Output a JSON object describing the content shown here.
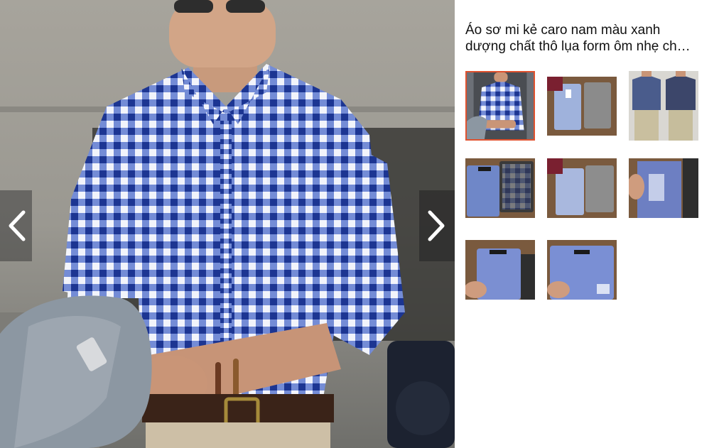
{
  "product": {
    "title_line1": "Áo sơ mi kẻ caro nam màu xanh",
    "title_line2": "dượng chất thô lụa form ôm nhẹ ch…"
  },
  "viewer": {
    "prev_icon": "chevron-left-icon",
    "next_icon": "chevron-right-icon",
    "selected_index": 0
  },
  "thumbnails": [
    {
      "name": "thumbnail-1",
      "subject": "model wearing blue gingham shirt"
    },
    {
      "name": "thumbnail-2",
      "subject": "two folded shirts on wood"
    },
    {
      "name": "thumbnail-3",
      "subject": "two models in checked shirts"
    },
    {
      "name": "thumbnail-4",
      "subject": "blue and black check shirts"
    },
    {
      "name": "thumbnail-5",
      "subject": "folded shirts with flag"
    },
    {
      "name": "thumbnail-6",
      "subject": "hand holding blue and black shirts"
    },
    {
      "name": "thumbnail-7",
      "subject": "hand holding checked shirt"
    },
    {
      "name": "thumbnail-8",
      "subject": "blue checked shirt close-up"
    }
  ],
  "colors": {
    "selected_border": "#e0522f",
    "shirt_blue": "#1f3f9e"
  }
}
